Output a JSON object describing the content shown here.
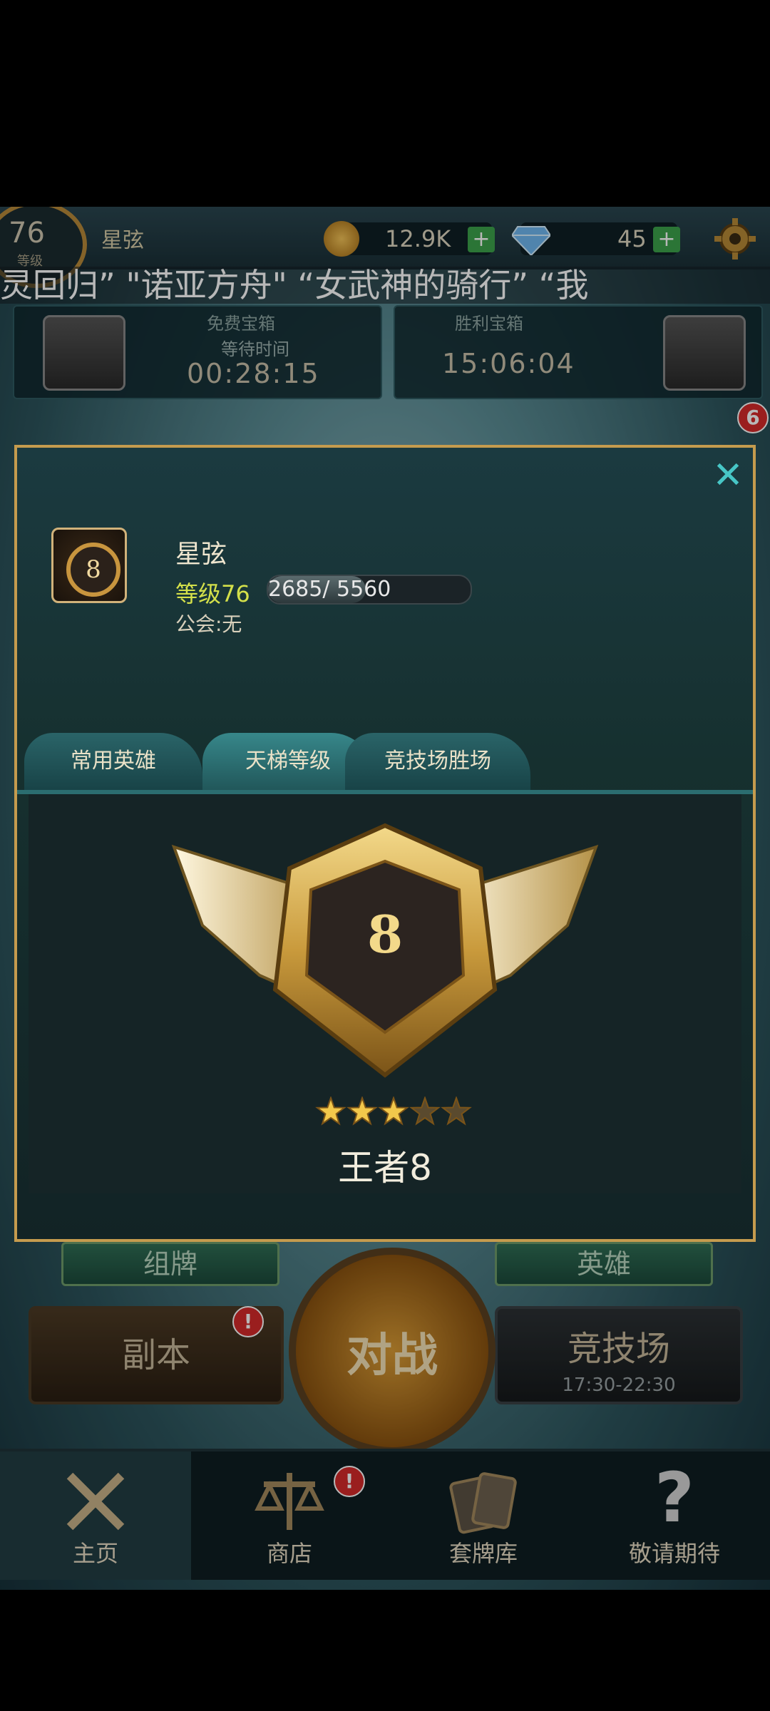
{
  "header": {
    "level": "76",
    "level_label": "等级",
    "player_name": "星弦",
    "gold": "12.9K",
    "gems": "45"
  },
  "marquee": "灵回归” \"诺亚方舟\" “女武神的骑行” “我",
  "chests": [
    {
      "title": "免费宝箱",
      "sub": "等待时间",
      "countdown": "00:28:15"
    },
    {
      "title": "胜利宝箱",
      "countdown": "15:06:04"
    }
  ],
  "side_badge": "6",
  "lower": {
    "deck_label": "组牌",
    "hero_label": "英雄",
    "dungeon_label": "副本",
    "battle_label": "对战",
    "arena_label": "竞技场",
    "arena_time": "17:30-22:30"
  },
  "nav": [
    {
      "label": "主页",
      "icon": "swords-icon"
    },
    {
      "label": "商店",
      "icon": "scales-icon"
    },
    {
      "label": "套牌库",
      "icon": "cards-icon"
    },
    {
      "label": "敬请期待",
      "icon": "question-icon"
    }
  ],
  "modal": {
    "name": "星弦",
    "level_text": "等级76",
    "xp_text": "2685/ 5560",
    "xp_current": 2685,
    "xp_max": 5560,
    "guild_text": "公会:无",
    "avatar_rank": "8",
    "tabs": [
      "常用英雄",
      "天梯等级",
      "竞技场胜场"
    ],
    "active_tab": 1,
    "rank_number": "8",
    "stars_filled": 3,
    "stars_total": 5,
    "rank_name": "王者8"
  },
  "colors": {
    "accent_gold": "#c59b4e",
    "teal": "#47c6c6",
    "level_yellow": "#d4e04a",
    "badge_red": "#d62a2a"
  }
}
